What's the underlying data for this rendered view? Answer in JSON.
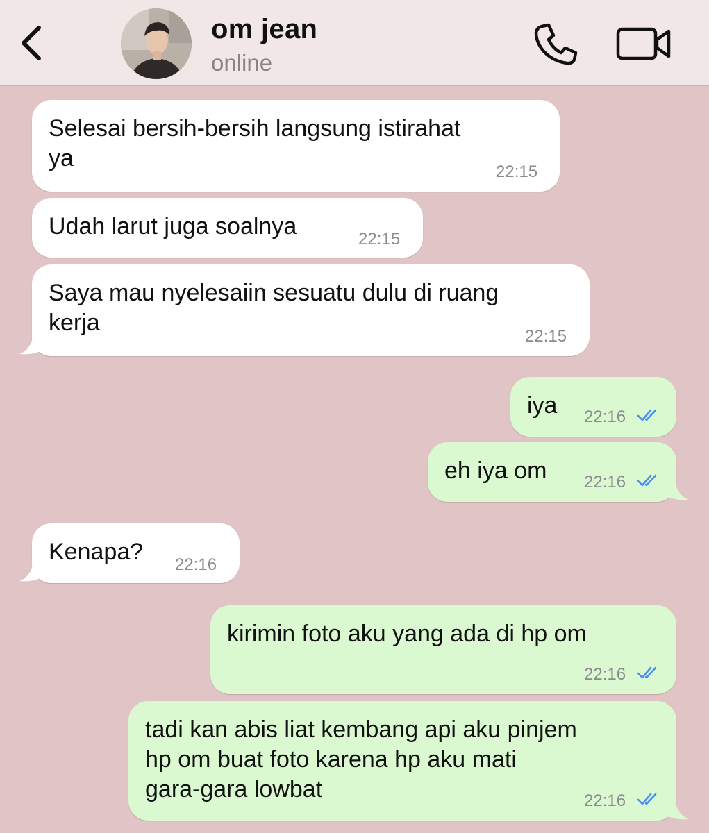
{
  "header": {
    "back_icon": "chevron-left-icon",
    "contact_name": "om jean",
    "status": "online",
    "call_icon": "phone-icon",
    "video_icon": "video-camera-icon"
  },
  "messages": [
    {
      "direction": "incoming",
      "text": "Selesai bersih-bersih langsung istirahat\nya",
      "time": "22:15"
    },
    {
      "direction": "incoming",
      "text": "Udah larut juga soalnya",
      "time": "22:15"
    },
    {
      "direction": "incoming",
      "text": "Saya mau nyelesaiin sesuatu dulu di ruang\nkerja",
      "time": "22:15"
    },
    {
      "direction": "outgoing",
      "text": "iya",
      "time": "22:16",
      "read": true
    },
    {
      "direction": "outgoing",
      "text": "eh iya om",
      "time": "22:16",
      "read": true
    },
    {
      "direction": "incoming",
      "text": "Kenapa?",
      "time": "22:16"
    },
    {
      "direction": "outgoing",
      "text": "kirimin foto aku yang ada di hp om",
      "time": "22:16",
      "read": true
    },
    {
      "direction": "outgoing",
      "text": "tadi kan abis liat kembang api aku pinjem\nhp om buat foto karena hp aku mati\ngara-gara lowbat",
      "time": "22:16",
      "read": true
    }
  ],
  "colors": {
    "chat_background": "#e1c4c5",
    "header_background": "#f2e7e7",
    "incoming_bubble": "#ffffff",
    "outgoing_bubble": "#dbf9d0",
    "read_ticks": "#4a8ef0"
  }
}
